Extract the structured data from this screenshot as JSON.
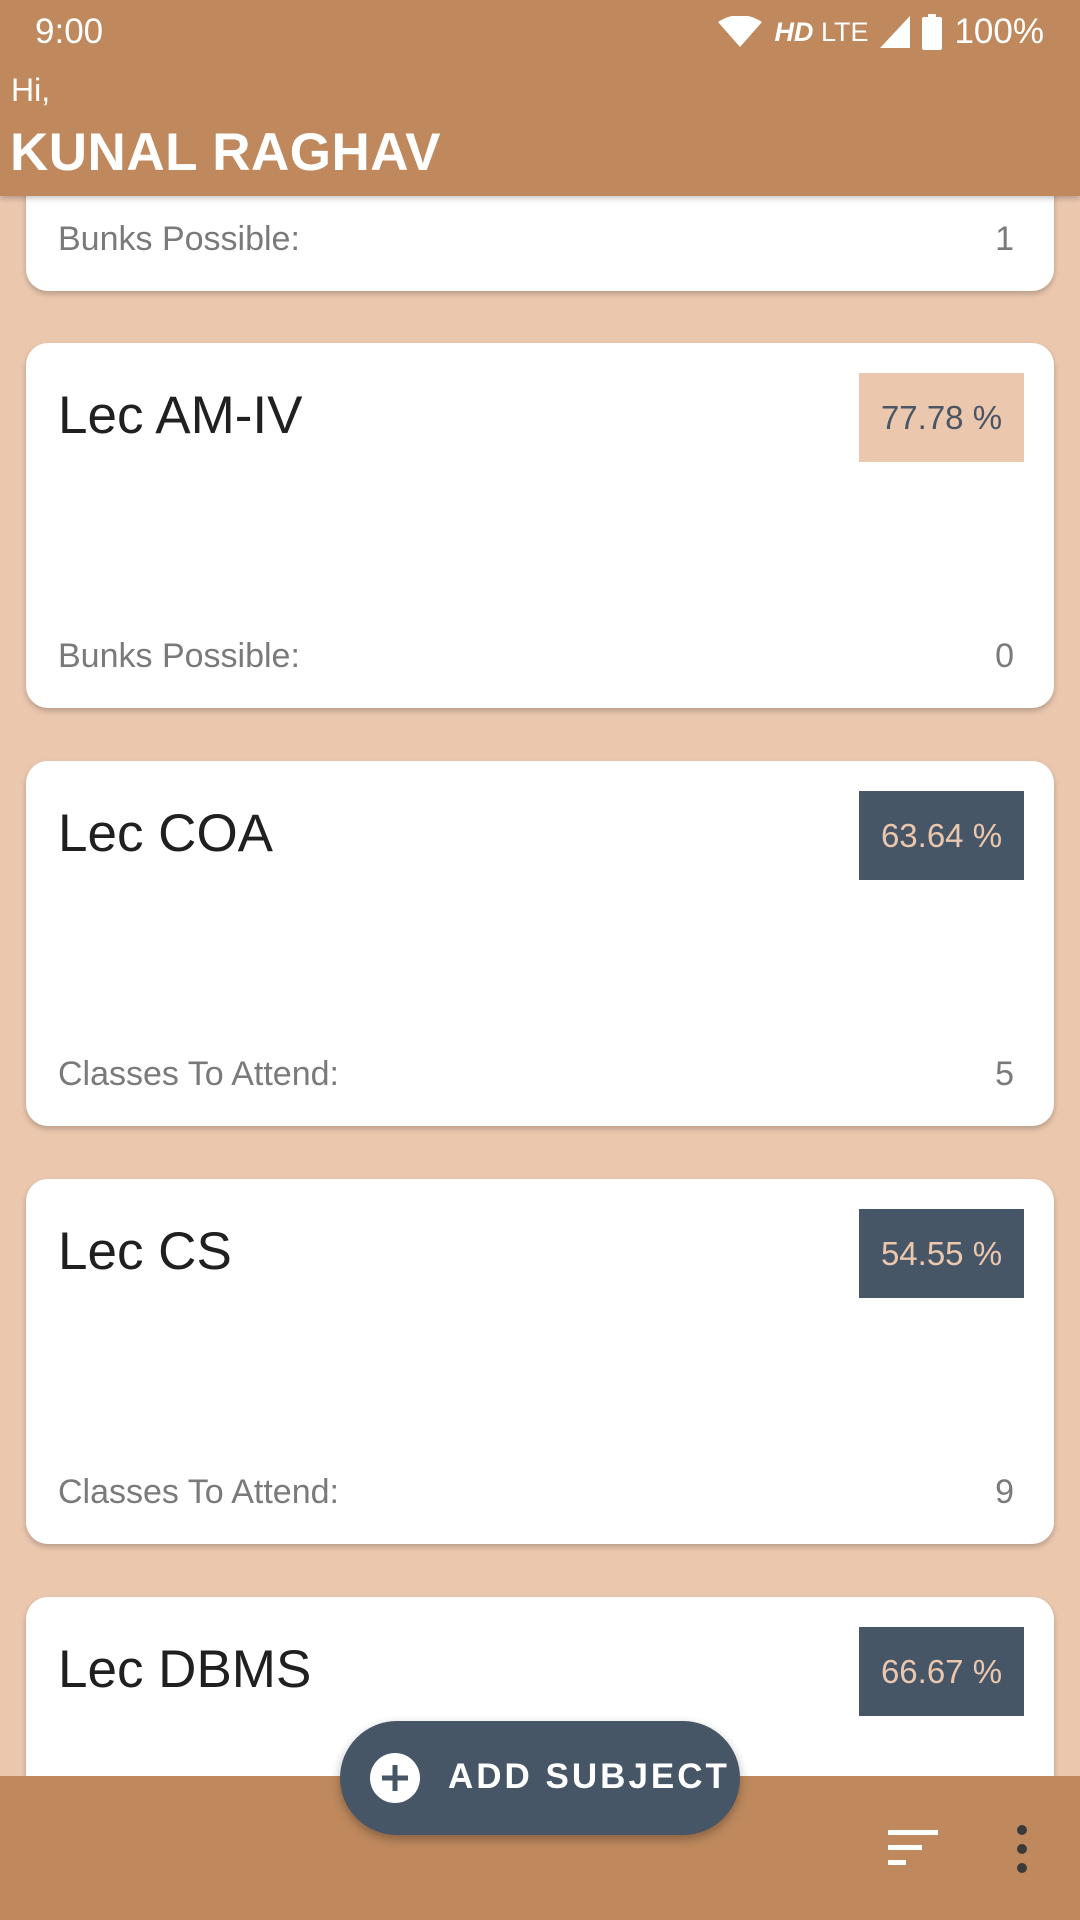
{
  "status_bar": {
    "time": "9:00",
    "network_hd": "HD",
    "network_lte": "LTE",
    "battery": "100%"
  },
  "header": {
    "greeting": "Hi,",
    "name": "KUNAL RAGHAV"
  },
  "subjects": [
    {
      "title": "",
      "percentage": "",
      "foot_label": "Bunks Possible:",
      "foot_value": "1"
    },
    {
      "title": "Lec AM-IV",
      "percentage": "77.78 %",
      "status": "good",
      "foot_label": "Bunks Possible:",
      "foot_value": "0"
    },
    {
      "title": "Lec COA",
      "percentage": "63.64 %",
      "status": "bad",
      "foot_label": "Classes To Attend:",
      "foot_value": "5"
    },
    {
      "title": "Lec CS",
      "percentage": "54.55 %",
      "status": "bad",
      "foot_label": "Classes To Attend:",
      "foot_value": "9"
    },
    {
      "title": "Lec DBMS",
      "percentage": "66.67 %",
      "status": "bad",
      "foot_label": "",
      "foot_value": ""
    }
  ],
  "fab": {
    "label": "ADD SUBJECT",
    "icon": "add-circle-icon"
  },
  "bottom_bar": {
    "sort_icon": "sort-icon",
    "more_icon": "more-vert-icon"
  },
  "colors": {
    "header": "#BF895D",
    "background": "#EBC7AE",
    "badge_good_bg": "#EBC7AE",
    "badge_bad_bg": "#475666",
    "fab_bg": "#475666"
  }
}
